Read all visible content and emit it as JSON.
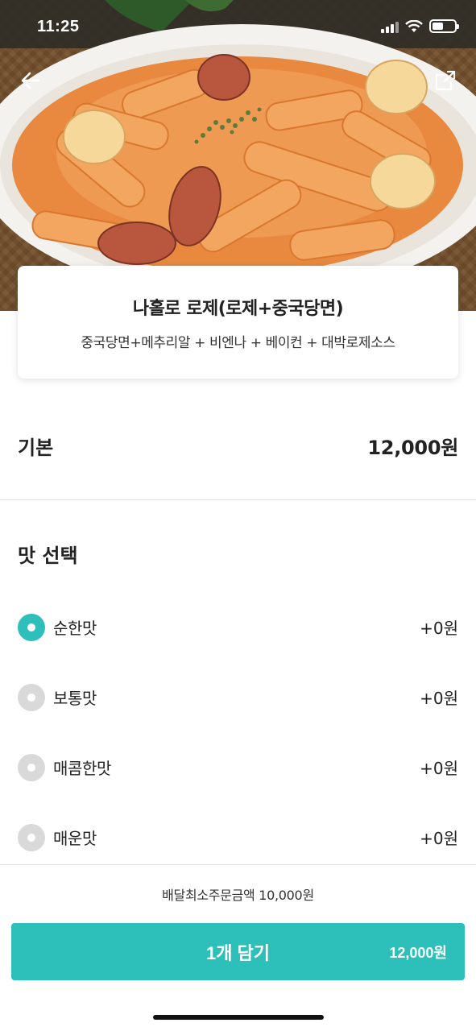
{
  "status_bar": {
    "time": "11:25",
    "icons": [
      "signal-icon",
      "wifi-icon",
      "battery-icon"
    ]
  },
  "header": {
    "back_icon": "arrow-left-icon",
    "share_icon": "share-icon"
  },
  "menu": {
    "title": "나홀로 로제(로제+중국당면)",
    "description": "중국당면+메추리알 + 비엔나 + 베이컨 + 대박로제소스"
  },
  "base": {
    "label": "기본",
    "price": "12,000원"
  },
  "taste_section": {
    "title": "맛 선택",
    "options": [
      {
        "label": "순한맛",
        "price": "+0원",
        "selected": true
      },
      {
        "label": "보통맛",
        "price": "+0원",
        "selected": false
      },
      {
        "label": "매콤한맛",
        "price": "+0원",
        "selected": false
      },
      {
        "label": "매운맛",
        "price": "+0원",
        "selected": false
      }
    ]
  },
  "footer": {
    "min_order": "배달최소주문금액 10,000원",
    "cart_label": "1개 담기",
    "cart_price": "12,000원"
  },
  "colors": {
    "accent": "#2dbfba",
    "radio_off": "#d9d9d9",
    "sauce": "#e8893f"
  }
}
